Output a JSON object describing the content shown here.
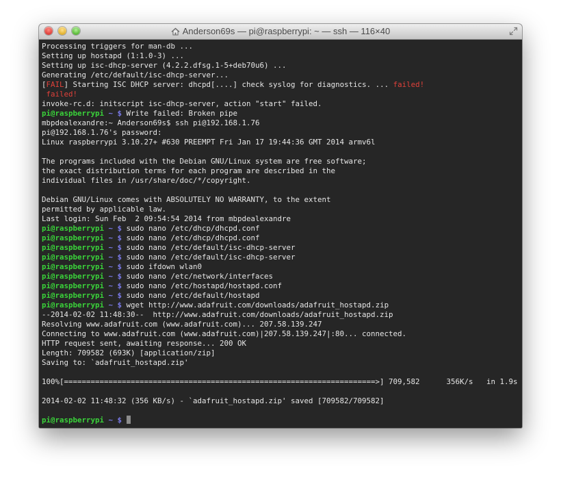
{
  "window": {
    "title": "Anderson69s — pi@raspberrypi: ~ — ssh — 116×40",
    "icon": "home-icon"
  },
  "terminal": {
    "prompt_user": "pi@raspberrypi",
    "prompt_path": "~ $",
    "lines": [
      {
        "type": "text",
        "text": "Processing triggers for man-db ..."
      },
      {
        "type": "text",
        "text": "Setting up hostapd (1:1.0-3) ..."
      },
      {
        "type": "text",
        "text": "Setting up isc-dhcp-server (4.2.2.dfsg.1-5+deb70u6) ..."
      },
      {
        "type": "text",
        "text": "Generating /etc/default/isc-dhcp-server..."
      },
      {
        "type": "fail",
        "bracket_open": "[",
        "fail_word": "FAIL",
        "bracket_close": "]",
        "middle": " Starting ISC DHCP server: dhcpd[....] check syslog for diagnostics. ... ",
        "failed": "failed!"
      },
      {
        "type": "red",
        "text": " failed!"
      },
      {
        "type": "text",
        "text": "invoke-rc.d: initscript isc-dhcp-server, action \"start\" failed."
      },
      {
        "type": "prompt",
        "cmd": " Write failed: Broken pipe"
      },
      {
        "type": "text",
        "text": "mbpdealexandre:~ Anderson69s$ ssh pi@192.168.1.76"
      },
      {
        "type": "text",
        "text": "pi@192.168.1.76's password:"
      },
      {
        "type": "text",
        "text": "Linux raspberrypi 3.10.27+ #630 PREEMPT Fri Jan 17 19:44:36 GMT 2014 armv6l"
      },
      {
        "type": "text",
        "text": ""
      },
      {
        "type": "text",
        "text": "The programs included with the Debian GNU/Linux system are free software;"
      },
      {
        "type": "text",
        "text": "the exact distribution terms for each program are described in the"
      },
      {
        "type": "text",
        "text": "individual files in /usr/share/doc/*/copyright."
      },
      {
        "type": "text",
        "text": ""
      },
      {
        "type": "text",
        "text": "Debian GNU/Linux comes with ABSOLUTELY NO WARRANTY, to the extent"
      },
      {
        "type": "text",
        "text": "permitted by applicable law."
      },
      {
        "type": "text",
        "text": "Last login: Sun Feb  2 09:54:54 2014 from mbpdealexandre"
      },
      {
        "type": "prompt",
        "cmd": " sudo nano /etc/dhcp/dhcpd.conf"
      },
      {
        "type": "prompt",
        "cmd": " sudo nano /etc/dhcp/dhcpd.conf"
      },
      {
        "type": "prompt",
        "cmd": " sudo nano /etc/default/isc-dhcp-server"
      },
      {
        "type": "prompt",
        "cmd": " sudo nano /etc/default/isc-dhcp-server"
      },
      {
        "type": "prompt",
        "cmd": " sudo ifdown wlan0"
      },
      {
        "type": "prompt",
        "cmd": " sudo nano /etc/network/interfaces"
      },
      {
        "type": "prompt",
        "cmd": " sudo nano /etc/hostapd/hostapd.conf"
      },
      {
        "type": "prompt",
        "cmd": " sudo nano /etc/default/hostapd"
      },
      {
        "type": "prompt",
        "cmd": " wget http://www.adafruit.com/downloads/adafruit_hostapd.zip"
      },
      {
        "type": "text",
        "text": "--2014-02-02 11:48:30--  http://www.adafruit.com/downloads/adafruit_hostapd.zip"
      },
      {
        "type": "text",
        "text": "Resolving www.adafruit.com (www.adafruit.com)... 207.58.139.247"
      },
      {
        "type": "text",
        "text": "Connecting to www.adafruit.com (www.adafruit.com)|207.58.139.247|:80... connected."
      },
      {
        "type": "text",
        "text": "HTTP request sent, awaiting response... 200 OK"
      },
      {
        "type": "text",
        "text": "Length: 709582 (693K) [application/zip]"
      },
      {
        "type": "text",
        "text": "Saving to: `adafruit_hostapd.zip'"
      },
      {
        "type": "text",
        "text": ""
      },
      {
        "type": "text",
        "text": "100%[======================================================================>] 709,582      356K/s   in 1.9s"
      },
      {
        "type": "text",
        "text": ""
      },
      {
        "type": "text",
        "text": "2014-02-02 11:48:32 (356 KB/s) - `adafruit_hostapd.zip' saved [709582/709582]"
      },
      {
        "type": "text",
        "text": ""
      },
      {
        "type": "prompt_cursor",
        "cmd": " "
      }
    ]
  },
  "colors": {
    "prompt_user": "#3ad33a",
    "prompt_path": "#7a7ae8",
    "error": "#e0413a",
    "background": "#262626",
    "foreground": "#e6e6e6"
  }
}
